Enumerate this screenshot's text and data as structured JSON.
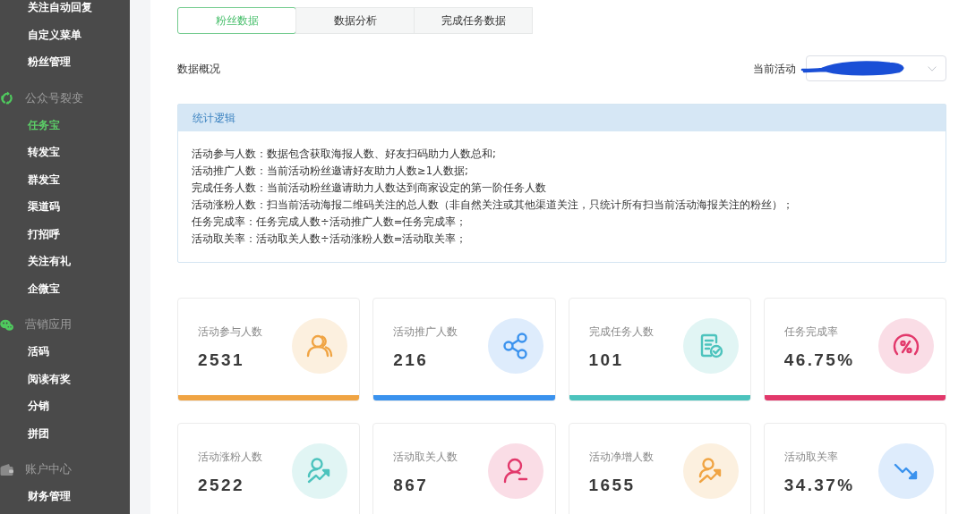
{
  "sidebar": {
    "sections": [
      {
        "items": [
          {
            "label": "关注自动回复",
            "selected": false
          },
          {
            "label": "自定义菜单",
            "selected": false
          },
          {
            "label": "粉丝管理",
            "selected": false
          }
        ]
      },
      {
        "title": "公众号裂变",
        "items": [
          {
            "label": "任务宝",
            "selected": true
          },
          {
            "label": "转发宝",
            "selected": false
          },
          {
            "label": "群发宝",
            "selected": false
          },
          {
            "label": "渠道码",
            "selected": false
          },
          {
            "label": "打招呼",
            "selected": false
          },
          {
            "label": "关注有礼",
            "selected": false
          },
          {
            "label": "企微宝",
            "selected": false
          }
        ]
      },
      {
        "title": "营销应用",
        "items": [
          {
            "label": "活码",
            "selected": false
          },
          {
            "label": "阅读有奖",
            "selected": false
          },
          {
            "label": "分销",
            "selected": false
          },
          {
            "label": "拼团",
            "selected": false
          }
        ]
      },
      {
        "title": "账户中心",
        "items": [
          {
            "label": "财务管理",
            "selected": false
          }
        ]
      }
    ]
  },
  "tabs": [
    {
      "label": "粉丝数据",
      "selected": true
    },
    {
      "label": "数据分析",
      "selected": false
    },
    {
      "label": "完成任务数据",
      "selected": false
    }
  ],
  "overview": {
    "title": "数据概况",
    "activity_label": "当前活动"
  },
  "logic_panel": {
    "title": "统计逻辑",
    "lines": [
      "活动参与人数：数据包含获取海报人数、好友扫码助力人数总和;",
      "活动推广人数：当前活动粉丝邀请好友助力人数≥1人数据;",
      "完成任务人数：当前活动粉丝邀请助力人数达到商家设定的第一阶任务人数",
      "活动涨粉人数：扫当前活动海报二维码关注的总人数（非自然关注或其他渠道关注，只统计所有扫当前活动海报关注的粉丝）；",
      "任务完成率：任务完成人数÷活动推广人数=任务完成率；",
      "活动取关率：活动取关人数÷活动涨粉人数=活动取关率；"
    ]
  },
  "cards": [
    {
      "label": "活动参与人数",
      "value": "2531",
      "color": "#f0a443"
    },
    {
      "label": "活动推广人数",
      "value": "216",
      "color": "#3a92ee"
    },
    {
      "label": "完成任务人数",
      "value": "101",
      "color": "#4cc3bd"
    },
    {
      "label": "任务完成率",
      "value": "46.75%",
      "color": "#e2386b"
    },
    {
      "label": "活动涨粉人数",
      "value": "2522",
      "color": "#4cc3bd"
    },
    {
      "label": "活动取关人数",
      "value": "867",
      "color": "#e2386b"
    },
    {
      "label": "活动净增人数",
      "value": "1655",
      "color": "#f0a443"
    },
    {
      "label": "活动取关率",
      "value": "34.37%",
      "color": "#3a92ee"
    }
  ]
}
